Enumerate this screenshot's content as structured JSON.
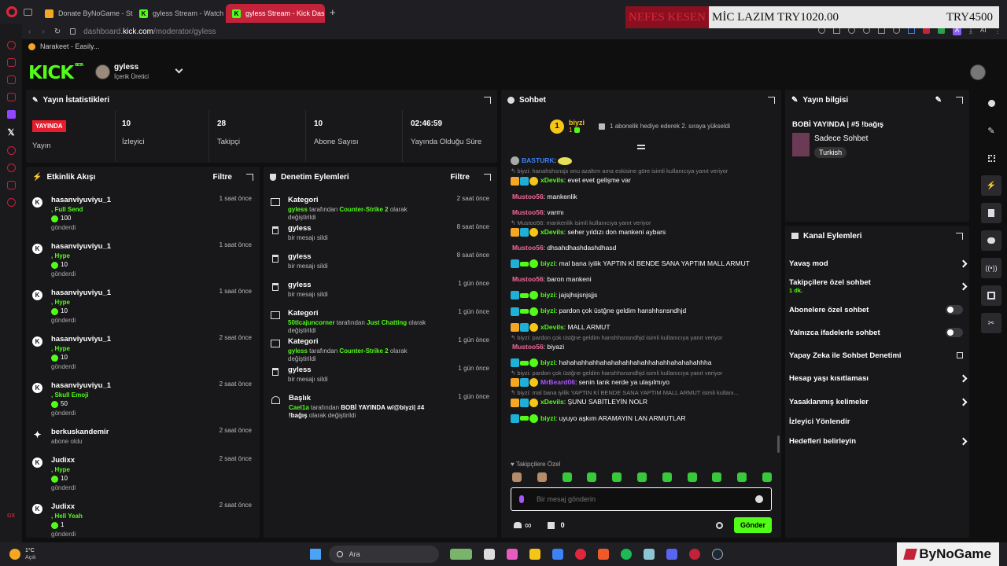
{
  "browser": {
    "tabs": [
      {
        "label": "Donate ByNoGame - Strea",
        "icon_color": "#f5a623"
      },
      {
        "label": "gyless Stream - Watch Liv",
        "icon_color": "#53fc18"
      },
      {
        "label": "gyless Stream - Kick Dash",
        "icon_color": "#53fc18"
      }
    ],
    "new_tab": "+",
    "url_host": "dashboard.",
    "url_domain": "kick.com",
    "url_path": "/moderator/gyless",
    "bookmark": "Narakeet - Easily...",
    "ai_label": "AI"
  },
  "overlay": {
    "red_text": "NEFES KESEN",
    "middle_text": "MİC LAZIM TRY1020.00",
    "right_text": "TRY4500"
  },
  "header": {
    "logo": "KICK",
    "logo_tag": "BETA",
    "user_name": "gyless",
    "user_role": "İçerik Üretici"
  },
  "stats": {
    "title": "Yayın İstatistikleri",
    "live_badge": "YAYINDA",
    "live_label": "Yayın",
    "items": [
      {
        "value": "10",
        "label": "İzleyici"
      },
      {
        "value": "28",
        "label": "Takipçi"
      },
      {
        "value": "10",
        "label": "Abone Sayısı"
      },
      {
        "value": "02:46:59",
        "label": "Yayında Olduğu Süre"
      }
    ]
  },
  "activity": {
    "title": "Etkinlik Akışı",
    "filter": "Filtre",
    "items": [
      {
        "user": "hasanviyuviyu_1",
        "type": ", Full Send",
        "amount": "100",
        "action": "gönderdi",
        "time": "1 saat önce"
      },
      {
        "user": "hasanviyuviyu_1",
        "type": ", Hype",
        "amount": "10",
        "action": "gönderdi",
        "time": "1 saat önce"
      },
      {
        "user": "hasanviyuviyu_1",
        "type": ", Hype",
        "amount": "10",
        "action": "gönderdi",
        "time": "1 saat önce"
      },
      {
        "user": "hasanviyuviyu_1",
        "type": ", Hype",
        "amount": "10",
        "action": "gönderdi",
        "time": "2 saat önce"
      },
      {
        "user": "hasanviyuviyu_1",
        "type": ", Skull Emoji",
        "amount": "50",
        "action": "gönderdi",
        "time": "2 saat önce"
      },
      {
        "user": "berkuskandemir",
        "type": "",
        "amount": "",
        "action": "abone oldu",
        "time": "2 saat önce"
      },
      {
        "user": "Judixx",
        "type": ", Hype",
        "amount": "10",
        "action": "gönderdi",
        "time": "2 saat önce"
      },
      {
        "user": "Judixx",
        "type": ", Hell Yeah",
        "amount": "1",
        "action": "gönderdi",
        "time": "2 saat önce"
      }
    ]
  },
  "moderation": {
    "title": "Denetim Eylemleri",
    "filter": "Filtre",
    "items": [
      {
        "icon": "category-icon",
        "title": "Kategori",
        "who": "gyless",
        "mid": " tarafından ",
        "target": "Counter-Strike 2",
        "tail": " olarak değiştirildi",
        "time": "2 saat önce"
      },
      {
        "icon": "trash-icon",
        "title": "gyless",
        "who": "",
        "mid": "bir mesajı sildi",
        "target": "",
        "tail": "",
        "time": "8 saat önce"
      },
      {
        "icon": "trash-icon",
        "title": "gyless",
        "who": "",
        "mid": "bir mesajı sildi",
        "target": "",
        "tail": "",
        "time": "8 saat önce"
      },
      {
        "icon": "trash-icon",
        "title": "gyless",
        "who": "",
        "mid": "bir mesajı sildi",
        "target": "",
        "tail": "",
        "time": "1 gün önce"
      },
      {
        "icon": "category-icon",
        "title": "Kategori",
        "who": "50tlcajuncorner",
        "mid": " tarafından ",
        "target": "Just Chatting",
        "tail": " olarak değiştirildi",
        "time": "1 gün önce"
      },
      {
        "icon": "category-icon",
        "title": "Kategori",
        "who": "gyless",
        "mid": " tarafından ",
        "target": "Counter-Strike 2",
        "tail": " olarak değiştirildi",
        "time": "1 gün önce"
      },
      {
        "icon": "trash-icon",
        "title": "gyless",
        "who": "",
        "mid": "bir mesajı sildi",
        "target": "",
        "tail": "",
        "time": "1 gün önce"
      },
      {
        "icon": "title-icon",
        "title": "Başlık",
        "who": "Cael1a",
        "mid": " tarafından ",
        "target": "BOBİ YAYINDA w/@biyzi| #4 !bağış",
        "tail": " olarak değiştirildi",
        "time": "1 gün önce"
      }
    ]
  },
  "chat": {
    "title": "Sohbet",
    "pinned_user": "biyzi",
    "pinned_count": "1",
    "pinned_text": "1 abonelik hediye ederek 2. sıraya yükseldi",
    "lines": [
      {
        "kind": "msg",
        "badges": [
          "bot"
        ],
        "user": "BASTURK",
        "color": "#3b82f6",
        "text": ""
      },
      {
        "kind": "reply",
        "text": "biyzi: hanahshsnsjs onu azaltım ama eskisine göre isimli kullanıcıya yanıt veriyor"
      },
      {
        "kind": "msg",
        "badges": [
          "crown",
          "sub",
          "one"
        ],
        "user": "xDevils",
        "color": "#53fc18",
        "text": "evet evet gelişme var"
      },
      {
        "kind": "msg",
        "badges": [],
        "user": "Mustoo56",
        "color": "#f0689a",
        "text": "mankenlik"
      },
      {
        "kind": "msg",
        "badges": [],
        "user": "Mustoo56",
        "color": "#f0689a",
        "text": "varmı"
      },
      {
        "kind": "reply",
        "text": "Mustoo56: mankenlik isimli kullanıcıya yanıt veriyor"
      },
      {
        "kind": "msg",
        "badges": [
          "crown",
          "sub",
          "one"
        ],
        "user": "xDevils",
        "color": "#53fc18",
        "text": "seher yıldızı don mankeni aybars"
      },
      {
        "kind": "msg",
        "badges": [],
        "user": "Mustoo56",
        "color": "#f0689a",
        "text": "dhsahdhashdashdhasd"
      },
      {
        "kind": "msg",
        "badges": [
          "mod",
          "gift",
          "verified"
        ],
        "user": "biyzi",
        "color": "#53fc18",
        "text": "mal bana iyilik YAPTIN Kİ BENDE SANA YAPTIM MALL ARMUT"
      },
      {
        "kind": "msg",
        "badges": [],
        "user": "Mustoo56",
        "color": "#f0689a",
        "text": "baron mankeni"
      },
      {
        "kind": "msg",
        "badges": [
          "mod",
          "gift",
          "verified"
        ],
        "user": "biyzi",
        "color": "#53fc18",
        "text": "jajsjhsjsnjsjjs"
      },
      {
        "kind": "msg",
        "badges": [
          "mod",
          "gift",
          "verified"
        ],
        "user": "biyzi",
        "color": "#53fc18",
        "text": "pardon çok üstğne geldim hanshhsnsndhjd"
      },
      {
        "kind": "msg",
        "badges": [
          "crown",
          "sub",
          "one"
        ],
        "user": "xDevils",
        "color": "#53fc18",
        "text": "MALL ARMUT"
      },
      {
        "kind": "reply",
        "text": "biyzi: pardon çok üstğne geldim hanshhsnsndhjd isimli kullanıcıya yanıt veriyor"
      },
      {
        "kind": "msg",
        "badges": [],
        "user": "Mustoo56",
        "color": "#f0689a",
        "text": "biyazi"
      },
      {
        "kind": "msg",
        "badges": [
          "mod",
          "gift",
          "verified"
        ],
        "user": "biyzi",
        "color": "#53fc18",
        "text": "hahahahhahhahahahahhahahhahahhahahahahhha"
      },
      {
        "kind": "reply",
        "text": "biyzi: pardon çok üstğne geldim hanshhsnsndhjd isimli kullanıcıya yanıt veriyor"
      },
      {
        "kind": "msg",
        "badges": [
          "crown",
          "sub",
          "one"
        ],
        "user": "MrBeard06",
        "color": "#a855f7",
        "text": "senin tarık nerde ya ulaşılmıyo"
      },
      {
        "kind": "reply",
        "text": "biyzi: mal bana iyilik YAPTIN Kİ BENDE SANA YAPTIM MALL ARMUT isimli kullanı..."
      },
      {
        "kind": "msg",
        "badges": [
          "crown",
          "sub",
          "one"
        ],
        "user": "xDevils",
        "color": "#53fc18",
        "text": "ŞUNU SABİTLEYİN NOLR"
      },
      {
        "kind": "msg",
        "badges": [
          "mod",
          "gift",
          "verified"
        ],
        "user": "biyzi",
        "color": "#53fc18",
        "text": "uyuyo aşkım ARAMAYIN LAN ARMUTLAR"
      }
    ],
    "follower_only": "Takipçilere Özel",
    "input_placeholder": "Bir mesaj gönderin",
    "infinite": "∞",
    "gift_count": "0",
    "send_label": "Gönder"
  },
  "stream_info": {
    "title": "Yayın bilgisi",
    "stream_title": "BOBİ YAYINDA | #5 !bağış",
    "category": "Sadece Sohbet",
    "tag": "Turkish"
  },
  "channel_actions": {
    "title": "Kanal Eylemleri",
    "items": [
      {
        "label": "Yavaş mod",
        "sub": "",
        "control": "chevron"
      },
      {
        "label": "Takipçilere özel sohbet",
        "sub": "1 dk.",
        "control": "chevron"
      },
      {
        "label": "Abonelere özel sohbet",
        "sub": "",
        "control": "toggle"
      },
      {
        "label": "Yalnızca ifadelerle sohbet",
        "sub": "",
        "control": "toggle"
      },
      {
        "label": "Yapay Zeka ile Sohbet Denetimi",
        "sub": "",
        "control": "external"
      },
      {
        "label": "Hesap yaşı kısıtlaması",
        "sub": "",
        "control": "chevron"
      },
      {
        "label": "Yasaklanmış kelimeler",
        "sub": "",
        "control": "chevron"
      },
      {
        "label": "İzleyici Yönlendir",
        "sub": "",
        "control": "none"
      },
      {
        "label": "Hedefleri belirleyin",
        "sub": "",
        "control": "chevron"
      }
    ]
  },
  "taskbar": {
    "weather_temp": "1°C",
    "weather_desc": "Açık",
    "search_label": "Ara",
    "brand": "ByNoGame"
  },
  "colors": {
    "kick_green": "#53fc18",
    "live_red": "#e81c2c",
    "panel_bg": "#18181b"
  }
}
